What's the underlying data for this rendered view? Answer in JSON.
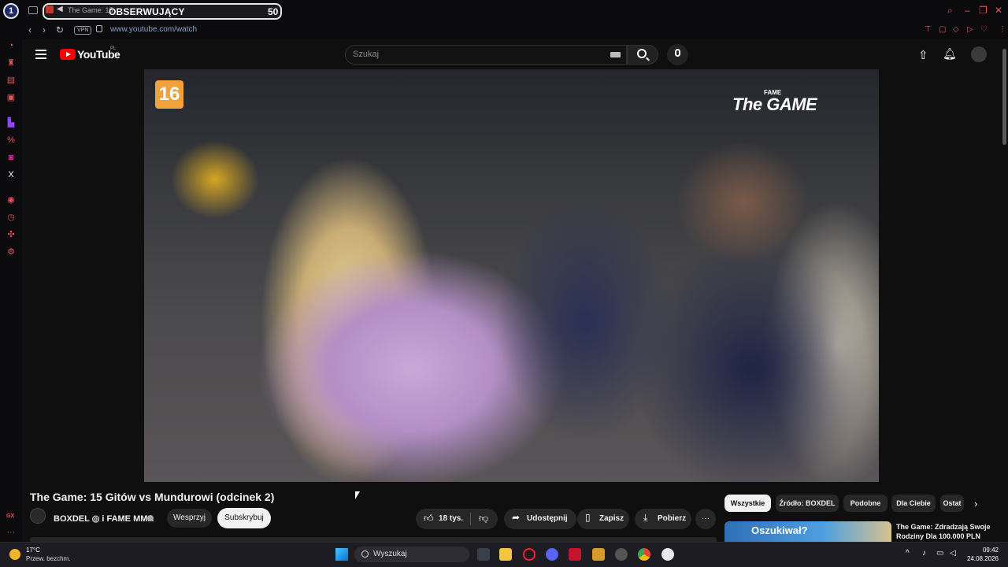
{
  "browser": {
    "tab_title": "The Game: 15",
    "overlay_label": "OBSERWUJĄCY",
    "overlay_count": "50",
    "vpn_label": "VPN",
    "url": "www.youtube.com/watch",
    "gx_label": "GX"
  },
  "youtube": {
    "logo_text": "YouTube",
    "region": "PL",
    "search_placeholder": "Szukaj"
  },
  "video": {
    "rating": "16",
    "watermark_small": "FAME",
    "watermark_large": "The GAME",
    "title": "The Game: 15 Gitów vs Mundurowi (odcinek 2)",
    "channel": "BOXDEL ◎ i FAME MMA",
    "join_label": "Wesprzyj",
    "subscribe_label": "Subskrybuj",
    "likes": "18 tys.",
    "share_label": "Udostępnij",
    "save_label": "Zapisz",
    "download_label": "Pobierz",
    "more_label": "···"
  },
  "chips": [
    "Wszystkie",
    "Źródło: BOXDEL",
    "Podobne",
    "Dla Ciebie",
    "Ostat"
  ],
  "recommended": {
    "thumb_text": "Oszukiwał?",
    "title": "The Game: Zdradzają Swoje Rodziny Dla 100.000 PLN"
  },
  "taskbar": {
    "weather_temp": "17°C",
    "weather_desc": "Przew. bezchm.",
    "search_label": "Wyszukaj",
    "time": "09:42",
    "date": "24.08.2026"
  },
  "colors": {
    "accent_red": "#e0575b",
    "youtube_red": "#ff0000",
    "rating_orange": "#f1a23a"
  }
}
